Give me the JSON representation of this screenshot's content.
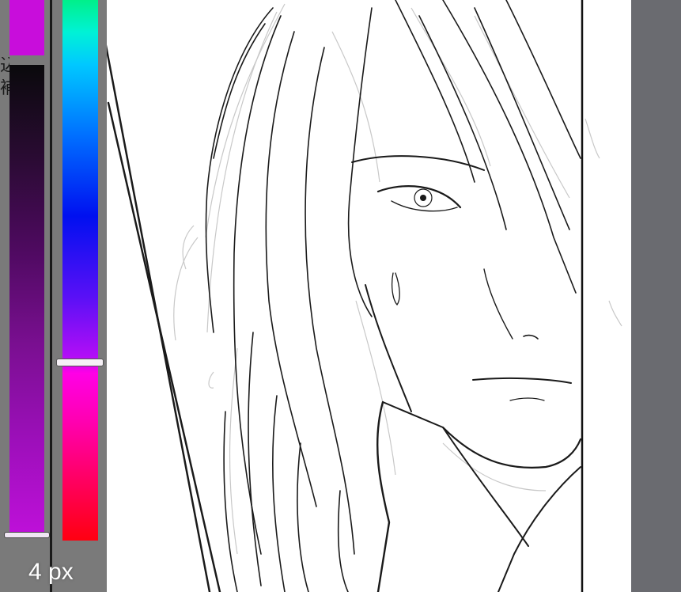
{
  "app": {
    "brush_size_label": "4 px",
    "partial_labels": [
      "込",
      "補"
    ]
  },
  "colors": {
    "selected_color": "#c80ddb",
    "panel_background": "#7a7a7a",
    "workspace_background": "#6a6b70",
    "canvas_background": "#ffffff",
    "line_art": "#1a1a1a"
  },
  "color_picker": {
    "hue_slider_level_percent": 67,
    "saturation_slider_level_percent": 99
  }
}
